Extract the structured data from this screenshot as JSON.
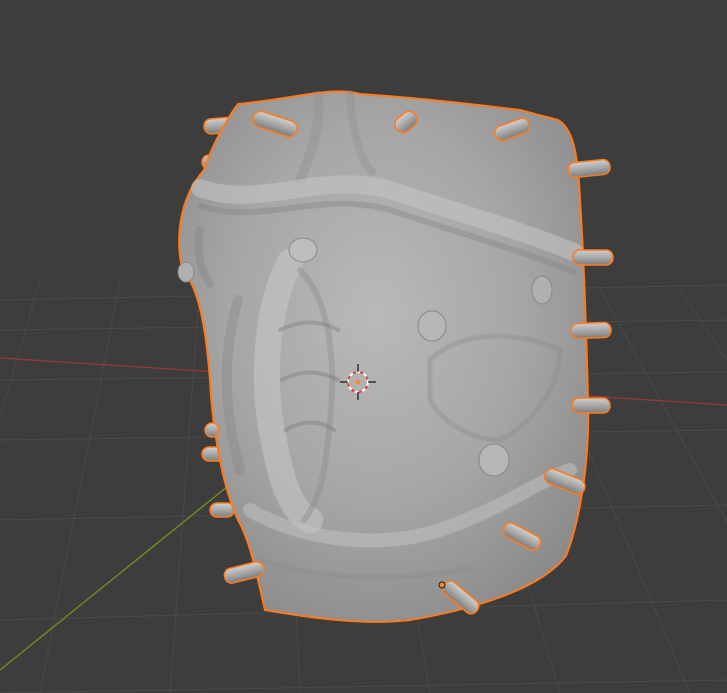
{
  "viewport": {
    "background": "#3d3d3d",
    "grid_color": "#4a4a4a",
    "x_axis_color": "#9a3a3a",
    "y_axis_color": "#6b8e23"
  },
  "object": {
    "selected": true,
    "outline_color": "#ff7a1a",
    "surface_color": "#a9a9a9",
    "pin_count": 16
  },
  "cursor_3d": {
    "icon": "3d-cursor-icon",
    "ring_color_a": "#ffffff",
    "ring_color_b": "#e0463a"
  },
  "origin_point": {
    "icon": "origin-dot-icon",
    "color": "#ff8a2a"
  }
}
